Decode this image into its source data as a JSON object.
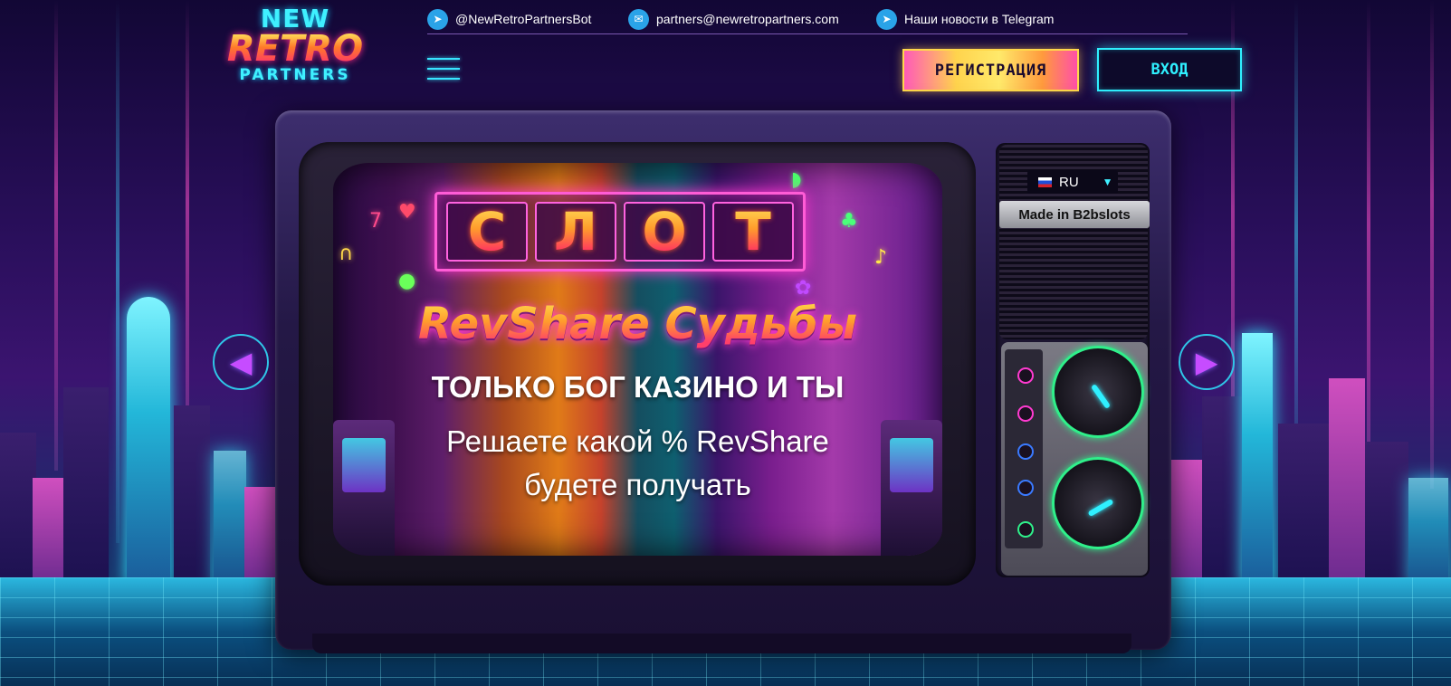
{
  "brand": {
    "logo_line1": "NEW",
    "logo_line2": "RETRO",
    "logo_line3": "PARTNERS"
  },
  "contacts": [
    {
      "icon": "telegram-icon",
      "text": "@NewRetroPartnersBot"
    },
    {
      "icon": "mail-icon",
      "text": "partners@newretropartners.com"
    },
    {
      "icon": "telegram-icon",
      "text": "Наши новости в Telegram"
    }
  ],
  "header": {
    "register_label": "РЕГИСТРАЦИЯ",
    "login_label": "ВХОД"
  },
  "banner": {
    "slot_letters": [
      "С",
      "Л",
      "О",
      "Т"
    ],
    "headline": "RevShare Судьбы",
    "subtitle": "ТОЛЬКО БОГ КАЗИНО И ТЫ",
    "body_line1": "Решаете какой % RevShare",
    "body_line2": "будете получать"
  },
  "tv_panel": {
    "language": "RU",
    "made_in": "Made in B2bslots"
  },
  "carousel": {
    "prev_icon": "arrow-left-icon",
    "next_icon": "arrow-right-icon"
  },
  "colors": {
    "neon_cyan": "#2ff0ff",
    "neon_pink": "#ff3ad0",
    "register_gold": "#ffd84a",
    "background": "#1a0b3a"
  }
}
